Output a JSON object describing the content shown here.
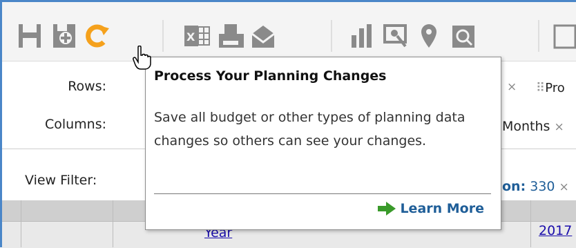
{
  "toolbar": {
    "icons": [
      "save-icon",
      "save-as-icon",
      "process-changes-icon",
      "excel-export-icon",
      "print-icon",
      "email-icon",
      "chart-icon",
      "drill-icon",
      "map-pin-icon",
      "find-icon",
      "view-icon"
    ],
    "accent": "#f5a11c",
    "icon_color": "#8a8a8a"
  },
  "layout": {
    "rows_label": "Rows:",
    "rows_chip_partial": "Pro",
    "columns_label": "Columns:",
    "columns_chip_partial": "Months",
    "view_filter_label": "View Filter:",
    "filter_chip_key_partial": "on:",
    "filter_chip_value": "330",
    "remove_glyph": "×"
  },
  "grid": {
    "header_link_partial": "Year",
    "year_value": "2017"
  },
  "tooltip": {
    "title": "Process Your Planning Changes",
    "body": "Save all budget or other types of planning data changes so others can see your changes.",
    "link_label": "Learn More",
    "link_color": "#1f5e98",
    "arrow_color": "#3a9a2a"
  }
}
